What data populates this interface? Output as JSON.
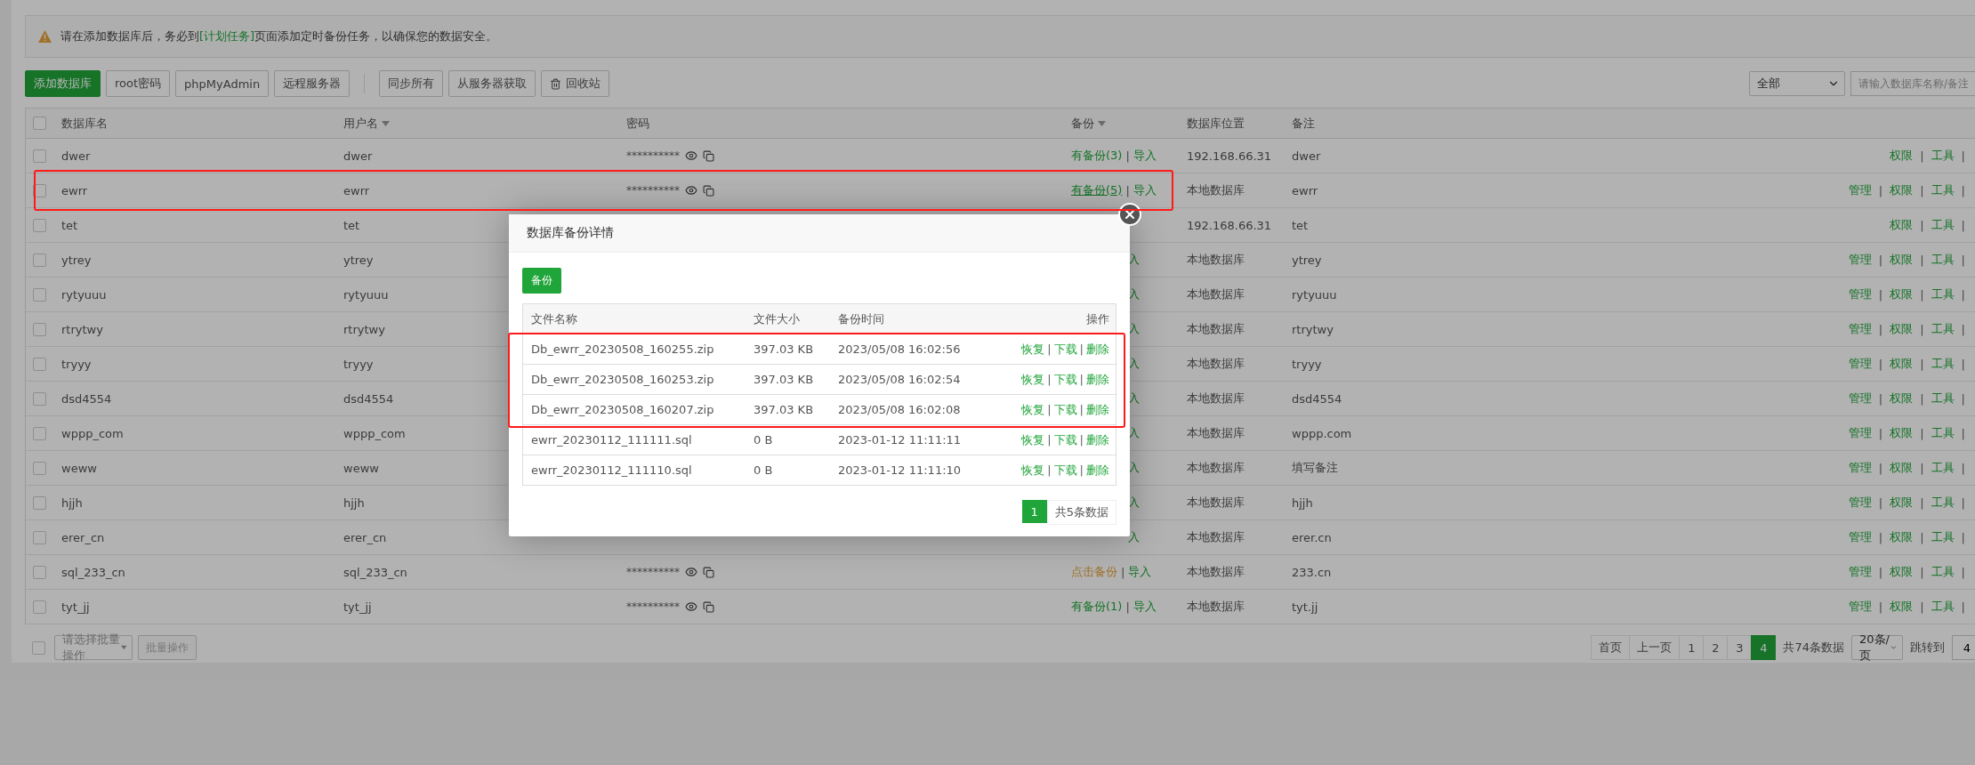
{
  "notice": {
    "before": "请在添加数据库后，务必到",
    "link": "[计划任务]",
    "after": "页面添加定时备份任务，以确保您的数据安全。"
  },
  "toolbar": {
    "buttons": [
      {
        "label": "添加数据库",
        "kind": "primary"
      },
      {
        "label": "root密码",
        "kind": "plain"
      },
      {
        "label": "phpMyAdmin",
        "kind": "plain"
      },
      {
        "label": "远程服务器",
        "kind": "plain"
      },
      {
        "label": "同步所有",
        "kind": "plain"
      },
      {
        "label": "从服务器获取",
        "kind": "plain"
      },
      {
        "label": "回收站",
        "kind": "trash"
      }
    ],
    "filter": "全部",
    "search_placeholder": "请输入数据库名称/备注"
  },
  "separator": "|",
  "table": {
    "select_all_checked": false,
    "columns": [
      {
        "label": "数据库名",
        "sortable": false
      },
      {
        "label": "用户名",
        "sortable": true
      },
      {
        "label": "密码",
        "sortable": false
      },
      {
        "label": "备份",
        "sortable": true
      },
      {
        "label": "数据库位置",
        "sortable": false
      },
      {
        "label": "备注",
        "sortable": false
      }
    ],
    "rows": [
      {
        "name": "dwer",
        "user": "dwer",
        "password": "**********",
        "backup": {
          "kind": "has",
          "label": "有备份(3)",
          "hovered": false
        },
        "import": "导入",
        "location": "192.168.66.31",
        "remark": "dwer",
        "ops": [
          "权限",
          "工具"
        ],
        "checked": false
      },
      {
        "name": "ewrr",
        "user": "ewrr",
        "password": "**********",
        "backup": {
          "kind": "has",
          "label": "有备份(5)",
          "hovered": true
        },
        "import": "导入",
        "location": "本地数据库",
        "remark": "ewrr",
        "ops": [
          "管理",
          "权限",
          "工具"
        ],
        "checked": false,
        "highlighted": true
      },
      {
        "name": "tet",
        "user": "tet",
        "location": "192.168.66.31",
        "remark": "tet",
        "ops": [
          "权限",
          "工具"
        ],
        "checked": false
      },
      {
        "name": "ytrey",
        "user": "ytrey",
        "import": "入",
        "location": "本地数据库",
        "remark": "ytrey",
        "ops": [
          "管理",
          "权限",
          "工具"
        ],
        "checked": false
      },
      {
        "name": "rytyuuu",
        "user": "rytyuuu",
        "import": "入",
        "location": "本地数据库",
        "remark": "rytyuuu",
        "ops": [
          "管理",
          "权限",
          "工具"
        ],
        "checked": false
      },
      {
        "name": "rtrytwy",
        "user": "rtrytwy",
        "import": "入",
        "location": "本地数据库",
        "remark": "rtrytwy",
        "ops": [
          "管理",
          "权限",
          "工具"
        ],
        "checked": false
      },
      {
        "name": "tryyy",
        "user": "tryyy",
        "import": "入",
        "location": "本地数据库",
        "remark": "tryyy",
        "ops": [
          "管理",
          "权限",
          "工具"
        ],
        "checked": false
      },
      {
        "name": "dsd4554",
        "user": "dsd4554",
        "import": "入",
        "location": "本地数据库",
        "remark": "dsd4554",
        "ops": [
          "管理",
          "权限",
          "工具"
        ],
        "checked": false
      },
      {
        "name": "wppp_com",
        "user": "wppp_com",
        "import": "入",
        "location": "本地数据库",
        "remark": "wppp.com",
        "ops": [
          "管理",
          "权限",
          "工具"
        ],
        "checked": false
      },
      {
        "name": "weww",
        "user": "weww",
        "import": "入",
        "location": "本地数据库",
        "remark": "填写备注",
        "ops": [
          "管理",
          "权限",
          "工具"
        ],
        "checked": false
      },
      {
        "name": "hjjh",
        "user": "hjjh",
        "import": "入",
        "location": "本地数据库",
        "remark": "hjjh",
        "ops": [
          "管理",
          "权限",
          "工具"
        ],
        "checked": false
      },
      {
        "name": "erer_cn",
        "user": "erer_cn",
        "import": "入",
        "location": "本地数据库",
        "remark": "erer.cn",
        "ops": [
          "管理",
          "权限",
          "工具"
        ],
        "checked": false
      },
      {
        "name": "sql_233_cn",
        "user": "sql_233_cn",
        "password": "**********",
        "backup": {
          "kind": "none",
          "label": "点击备份",
          "hovered": false
        },
        "import": "导入",
        "location": "本地数据库",
        "remark": "233.cn",
        "ops": [
          "管理",
          "权限",
          "工具"
        ],
        "checked": false
      },
      {
        "name": "tyt_jj",
        "user": "tyt_jj",
        "password": "**********",
        "backup": {
          "kind": "has",
          "label": "有备份(1)",
          "hovered": false
        },
        "import": "导入",
        "location": "本地数据库",
        "remark": "tyt.jj",
        "ops": [
          "管理",
          "权限",
          "工具"
        ],
        "checked": false
      }
    ]
  },
  "footer": {
    "batch_checked": false,
    "batch_placeholder": "请选择批量操作",
    "batch_button": "批量操作",
    "pages": [
      {
        "label": "首页",
        "selected": false
      },
      {
        "label": "上一页",
        "selected": false
      },
      {
        "label": "1",
        "selected": false
      },
      {
        "label": "2",
        "selected": false
      },
      {
        "label": "3",
        "selected": false
      },
      {
        "label": "4",
        "selected": true
      }
    ],
    "total": "共74条数据",
    "per_page": "20条/页",
    "jump_label": "跳转到",
    "jump_value": "4"
  },
  "modal": {
    "title": "数据库备份详情",
    "backup_button": "备份",
    "columns": [
      "文件名称",
      "文件大小",
      "备份时间",
      "操作"
    ],
    "rows": [
      {
        "file": "Db_ewrr_20230508_160255.zip",
        "size": "397.03 KB",
        "time": "2023/05/08 16:02:56",
        "ops": [
          "恢复",
          "下载",
          "删除"
        ],
        "highlighted": true
      },
      {
        "file": "Db_ewrr_20230508_160253.zip",
        "size": "397.03 KB",
        "time": "2023/05/08 16:02:54",
        "ops": [
          "恢复",
          "下载",
          "删除"
        ],
        "highlighted": true
      },
      {
        "file": "Db_ewrr_20230508_160207.zip",
        "size": "397.03 KB",
        "time": "2023/05/08 16:02:08",
        "ops": [
          "恢复",
          "下载",
          "删除"
        ],
        "highlighted": true
      },
      {
        "file": "ewrr_20230112_111111.sql",
        "size": "0 B",
        "time": "2023-01-12 11:11:11",
        "ops": [
          "恢复",
          "下载",
          "删除"
        ]
      },
      {
        "file": "ewrr_20230112_111110.sql",
        "size": "0 B",
        "time": "2023-01-12 11:11:10",
        "ops": [
          "恢复",
          "下载",
          "删除"
        ]
      }
    ],
    "pages": [
      {
        "label": "1",
        "selected": true
      }
    ],
    "total": "共5条数据"
  }
}
